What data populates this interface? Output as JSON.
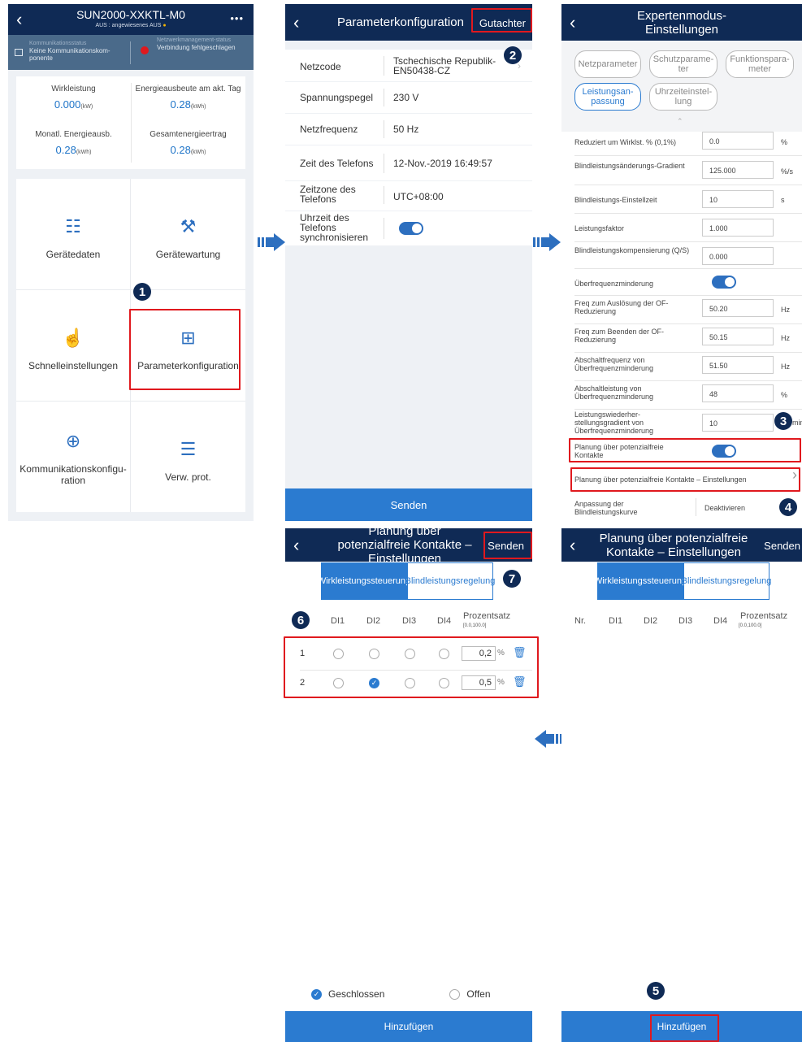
{
  "panel1": {
    "title": "SUN2000-XXKTL-M0",
    "subtitle": "AUS : angewiesenes AUS",
    "menu_icon": "more-icon",
    "status_left_label": "Kommunikationsstatus",
    "status_left_value": "Keine Kommunikationskom-ponente",
    "status_right_label": "Netzwerkmanagement-status",
    "status_right_value": "Verbindung fehlgeschlagen",
    "stats": [
      {
        "label": "Wirkleistung",
        "value": "0.000",
        "unit": "(kW)"
      },
      {
        "label": "Energieausbeute am akt. Tag",
        "value": "0.28",
        "unit": "(kWh)"
      },
      {
        "label": "Monatl. Energieausb.",
        "value": "0.28",
        "unit": "(kWh)"
      },
      {
        "label": "Gesamtenergieertrag",
        "value": "0.28",
        "unit": "(kWh)"
      }
    ],
    "tiles": [
      {
        "label": "Gerätedaten",
        "icon": "device-data-icon"
      },
      {
        "label": "Gerätewartung",
        "icon": "wrench-icon"
      },
      {
        "label": "Schnelleinstellungen",
        "icon": "hand-pointer-icon"
      },
      {
        "label": "Parameterkonfiguration",
        "icon": "config-icon"
      },
      {
        "label": "Kommunikationskonfigu-ration",
        "icon": "globe-icon"
      },
      {
        "label": "Verw. prot.",
        "icon": "log-icon"
      }
    ]
  },
  "panel2": {
    "title": "Parameterkonfiguration",
    "action": "Gutachter",
    "rows": [
      {
        "label": "Netzcode",
        "value": "Tschechische Republik-EN50438-CZ"
      },
      {
        "label": "Spannungspegel",
        "value": "230  V"
      },
      {
        "label": "Netzfrequenz",
        "value": "50  Hz"
      },
      {
        "label": "Zeit des Telefons",
        "value": "12-Nov.-2019 16:49:57"
      },
      {
        "label": "Zeitzone des Telefons",
        "value": "UTC+08:00"
      },
      {
        "label": "Uhrzeit des Telefons synchronisieren",
        "value": ""
      }
    ],
    "send": "Senden"
  },
  "panel3": {
    "title": "Expertenmodus-Einstellungen",
    "chips": [
      "Netzparameter",
      "Schutzparame-ter",
      "Funktionspara-meter",
      "Leistungsan-passung",
      "Uhrzeiteinstel-lung"
    ],
    "rows": [
      {
        "label": "Reduziert um Wirklst. % (0,1%)",
        "value": "0.0",
        "unit": "%"
      },
      {
        "label": "Blindleistungsänderungs-Gradient",
        "value": "125.000",
        "unit": "%/s"
      },
      {
        "label": "Blindleistungs-Einstellzeit",
        "value": "10",
        "unit": "s"
      },
      {
        "label": "Leistungsfaktor",
        "value": "1.000",
        "unit": ""
      },
      {
        "label": "Blindleistungskompensierung (Q/S)",
        "value": "0.000",
        "unit": ""
      },
      {
        "label": "Überfrequenzminderung",
        "value": "",
        "unit": ""
      },
      {
        "label": "Freq zum Auslösung der OF-Reduzierung",
        "value": "50.20",
        "unit": "Hz"
      },
      {
        "label": "Freq zum Beenden der OF-Reduzierung",
        "value": "50.15",
        "unit": "Hz"
      },
      {
        "label": "Abschaltfrequenz von Überfrequenzminderung",
        "value": "51.50",
        "unit": "Hz"
      },
      {
        "label": "Abschaltleistung von Überfrequenzminderung",
        "value": "48",
        "unit": "%"
      },
      {
        "label": "Leistungswiederher-stellungsgradient von Überfrequenzminderung",
        "value": "10",
        "unit": "min"
      }
    ],
    "dry_contact": "Planung über potenzialfreie Kontakte",
    "dry_contact_settings": "Planung über potenzialfreie Kontakte – Einstellungen",
    "curve_label": "Anpassung der Blindleistungskurve",
    "curve_value": "Deaktivieren"
  },
  "panel4": {
    "title": "Planung über potenzialfreie Kontakte – Einstellungen",
    "action": "Senden",
    "tab1": "Wirkleistungssteuerung",
    "tab2": "Blindleistungsregelung",
    "cols": [
      "DI1",
      "DI2",
      "DI3",
      "DI4"
    ],
    "pct_label": "Prozentsatz",
    "pct_range": "[0.0,100.0]",
    "rows": [
      {
        "nr": "1",
        "value": "0,2",
        "unit": "%"
      },
      {
        "nr": "2",
        "value": "0,5",
        "unit": "%"
      }
    ],
    "closed": "Geschlossen",
    "open": "Offen",
    "add": "Hinzufügen"
  },
  "panel5": {
    "title": "Planung über potenzialfreie Kontakte – Einstellungen",
    "action": "Senden",
    "tab1": "Wirkleistungssteuerung",
    "tab2": "Blindleistungsregelung",
    "nr": "Nr.",
    "cols": [
      "DI1",
      "DI2",
      "DI3",
      "DI4"
    ],
    "pct_label": "Prozentsatz",
    "pct_range": "[0.0,100.0]",
    "add": "Hinzufügen"
  },
  "badges": [
    "1",
    "2",
    "3",
    "4",
    "5",
    "6",
    "7"
  ],
  "colors": {
    "navy": "#0f2a55",
    "blue": "#2b7bd0",
    "red": "#e0191e"
  }
}
